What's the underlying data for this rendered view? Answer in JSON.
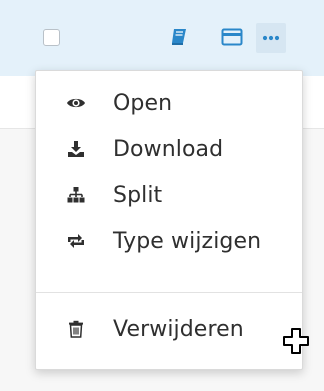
{
  "menu": {
    "items": [
      {
        "label": "Open",
        "icon": "eye-icon"
      },
      {
        "label": "Download",
        "icon": "download-icon"
      },
      {
        "label": "Split",
        "icon": "sitemap-icon"
      },
      {
        "label": "Type wijzigen",
        "icon": "swap-icon"
      }
    ],
    "delete": {
      "label": "Verwijderen",
      "icon": "trash-icon"
    }
  },
  "toolbar": {
    "icons": [
      "checkbox",
      "book-icon",
      "credit-card-icon",
      "more-icon"
    ]
  },
  "colors": {
    "toolbar_bg": "#e4f1fa",
    "accent": "#2a87c9",
    "text": "#2f2f2f"
  }
}
